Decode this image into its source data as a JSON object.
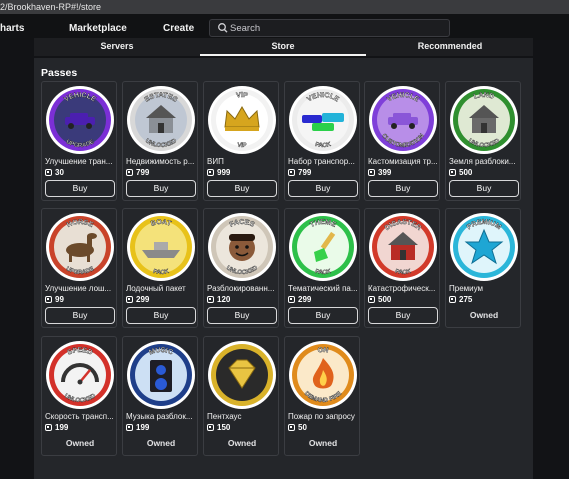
{
  "browser": {
    "url_text": "2/Brookhaven-RP#!/store"
  },
  "topnav": {
    "items": [
      "harts",
      "Marketplace",
      "Create"
    ],
    "search_placeholder": "Search"
  },
  "tabs": [
    "Servers",
    "Store",
    "Recommended"
  ],
  "section_title": "Passes",
  "buy_label": "Buy",
  "owned_label": "Owned",
  "passes": [
    {
      "title": "Улучшение тран...",
      "price": "30",
      "status": "buy",
      "badge_top": "VEHICLE",
      "badge_bottom": "UPGRADE",
      "ring": "#7b2fd6",
      "bg": "#3a3a7a",
      "icon": "car",
      "icon_color": "#4b1fb0"
    },
    {
      "title": "Недвижимость р...",
      "price": "799",
      "status": "buy",
      "badge_top": "ESTATES",
      "badge_bottom": "UNLOCKED",
      "ring": "#d8d8d8",
      "bg": "#bfc7d3",
      "icon": "house",
      "icon_color": "#8a8f96"
    },
    {
      "title": "ВИП",
      "price": "999",
      "status": "buy",
      "badge_top": "VIP",
      "badge_bottom": "VIP",
      "ring": "#f2f2f2",
      "bg": "#ffffff",
      "icon": "crown",
      "icon_color": "#d6a51e"
    },
    {
      "title": "Набор транспор...",
      "price": "799",
      "status": "buy",
      "badge_top": "VEHICLE",
      "badge_bottom": "PACK",
      "ring": "#ececec",
      "bg": "#f5f5f5",
      "icon": "cars",
      "icon_color": "#23b3d9"
    },
    {
      "title": "Кастомизация тр...",
      "price": "399",
      "status": "buy",
      "badge_top": "VEHICLE",
      "badge_bottom": "CUSTOMIZATION",
      "ring": "#7f3fd9",
      "bg": "#b88ee8",
      "icon": "car",
      "icon_color": "#8a56d8"
    },
    {
      "title": "Земля разблоки...",
      "price": "500",
      "status": "buy",
      "badge_top": "LAND",
      "badge_bottom": "UNLOCKED",
      "ring": "#2f8f2f",
      "bg": "#dfe9d3",
      "icon": "house",
      "icon_color": "#6a6a6a"
    },
    {
      "title": "Улучшение лош...",
      "price": "99",
      "status": "buy",
      "badge_top": "HORSE",
      "badge_bottom": "UPGRADE",
      "ring": "#c9432a",
      "bg": "#e8dfd4",
      "icon": "horse",
      "icon_color": "#6b4a2b"
    },
    {
      "title": "Лодочный пакет",
      "price": "299",
      "status": "buy",
      "badge_top": "BOAT",
      "badge_bottom": "PACK",
      "ring": "#e8c21a",
      "bg": "#f4e27a",
      "icon": "boat",
      "icon_color": "#8a8a8a"
    },
    {
      "title": "Разблокированн...",
      "price": "120",
      "status": "buy",
      "badge_top": "FACES",
      "badge_bottom": "UNLOCKED",
      "ring": "#cfc6b8",
      "bg": "#ece6dc",
      "icon": "face",
      "icon_color": "#8a5a3a"
    },
    {
      "title": "Тематический па...",
      "price": "299",
      "status": "buy",
      "badge_top": "THEME",
      "badge_bottom": "PACK",
      "ring": "#2ec04a",
      "bg": "#eafbe9",
      "icon": "brush",
      "icon_color": "#e2b74a"
    },
    {
      "title": "Катастрофическ...",
      "price": "500",
      "status": "buy",
      "badge_top": "DISASTER",
      "badge_bottom": "PACK",
      "ring": "#d23a2a",
      "bg": "#f1d6d1",
      "icon": "house",
      "icon_color": "#b92c25"
    },
    {
      "title": "Премиум",
      "price": "275",
      "status": "owned",
      "badge_top": "PREMIUM",
      "badge_bottom": "",
      "ring": "#2bb6d9",
      "bg": "#dff5fb",
      "icon": "star",
      "icon_color": "#1ea6d4"
    },
    {
      "title": "Скорость трансп...",
      "price": "199",
      "status": "owned",
      "badge_top": "SPEED",
      "badge_bottom": "UNLOCKED",
      "ring": "#d3312a",
      "bg": "#f3f3f3",
      "icon": "gauge",
      "icon_color": "#333333"
    },
    {
      "title": "Музыка разблок...",
      "price": "199",
      "status": "owned",
      "badge_top": "MUSIC",
      "badge_bottom": "",
      "ring": "#1f3f8a",
      "bg": "#cde0f4",
      "icon": "speaker",
      "icon_color": "#1e1e26"
    },
    {
      "title": "Пентхаус",
      "price": "150",
      "status": "owned",
      "badge_top": "",
      "badge_bottom": "",
      "ring": "#d9b22a",
      "bg": "#2a2a2a",
      "icon": "diamond",
      "icon_color": "#e9c442"
    },
    {
      "title": "Пожар по запросу",
      "price": "50",
      "status": "owned",
      "badge_top": "ON",
      "badge_bottom": "DEMAND FIRE",
      "ring": "#e08b1c",
      "bg": "#fbe9c9",
      "icon": "fire",
      "icon_color": "#e0621c"
    }
  ]
}
